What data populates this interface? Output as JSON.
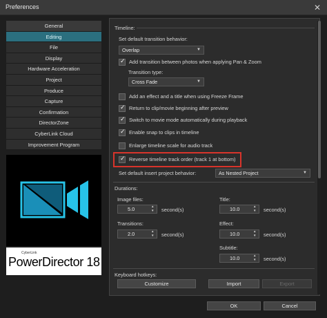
{
  "window": {
    "title": "Preferences",
    "close_glyph": "✕"
  },
  "nav": {
    "items": [
      {
        "label": "General"
      },
      {
        "label": "Editing"
      },
      {
        "label": "File"
      },
      {
        "label": "Display"
      },
      {
        "label": "Hardware Acceleration"
      },
      {
        "label": "Project"
      },
      {
        "label": "Produce"
      },
      {
        "label": "Capture"
      },
      {
        "label": "Confirmation"
      },
      {
        "label": "DirectorZone"
      },
      {
        "label": "CyberLink Cloud"
      },
      {
        "label": "Improvement Program"
      }
    ],
    "active_index": 1
  },
  "brand": {
    "small": "CyberLink",
    "product": "PowerDirector 18",
    "logo_icon": "powerdirector-logo-icon"
  },
  "timeline": {
    "group_label": "Timeline:",
    "transition_behavior_label": "Set default transition behavior:",
    "transition_behavior_value": "Overlap",
    "add_transition_label": "Add transition between photos when applying Pan & Zoom",
    "transition_type_label": "Transition type:",
    "transition_type_value": "Cross Fade",
    "effect_title_label": "Add an effect and a title when using Freeze Frame",
    "return_label": "Return to clip/movie beginning after preview",
    "switch_label": "Switch to movie mode automatically during playback",
    "snap_label": "Enable snap to clips in timeline",
    "enlarge_label": "Enlarge timeline scale for audio track",
    "reverse_label": "Reverse timeline track order (track 1 at bottom)",
    "insert_behavior_label": "Set default insert project behavior:",
    "insert_behavior_value": "As Nested Project"
  },
  "durations": {
    "group_label": "Durations:",
    "image_files_label": "Image files:",
    "image_files_value": "5.0",
    "transitions_label": "Transitions:",
    "transitions_value": "2.0",
    "title_label": "Title:",
    "title_value": "10.0",
    "effect_label": "Effect:",
    "effect_value": "10.0",
    "subtitle_label": "Subtitle:",
    "subtitle_value": "10.0",
    "unit": "second(s)"
  },
  "hotkeys": {
    "group_label": "Keyboard hotkeys:",
    "customize": "Customize",
    "import": "Import",
    "export": "Export"
  },
  "footer": {
    "ok": "OK",
    "cancel": "Cancel"
  }
}
